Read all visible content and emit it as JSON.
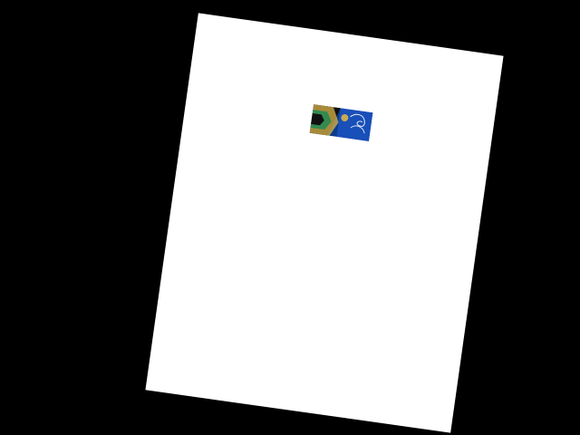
{
  "scene": {
    "background_color": "#000000",
    "paper_color": "#ffffff"
  },
  "card": {
    "script_text": "",
    "colors": {
      "navy": "#0b3c8a",
      "blue": "#1e56c7",
      "gold": "#d9b44a",
      "green": "#1f8a55",
      "black": "#111111",
      "white": "#ffffff"
    }
  }
}
